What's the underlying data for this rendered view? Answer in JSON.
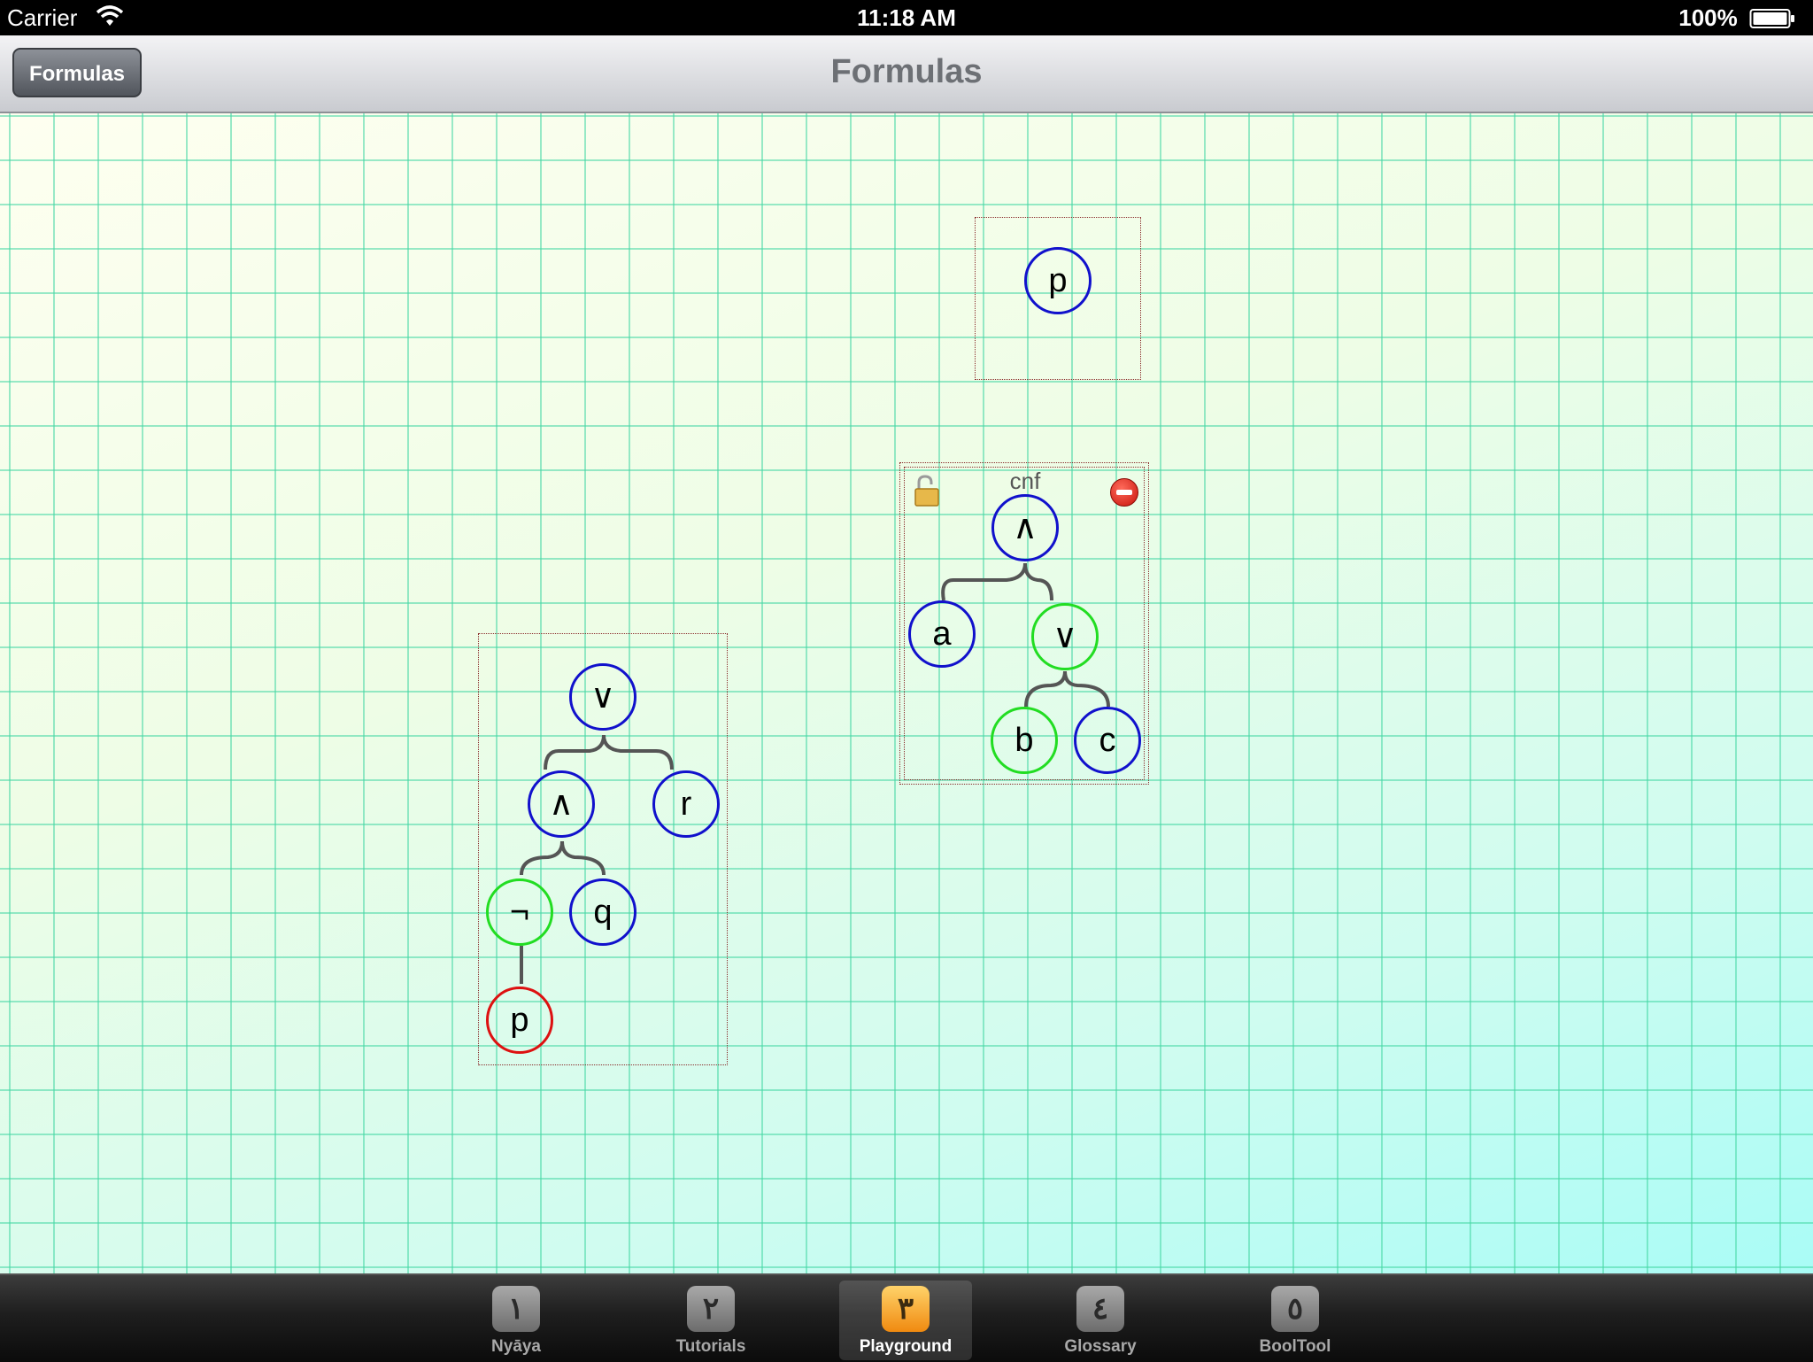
{
  "status_bar": {
    "carrier": "Carrier",
    "time": "11:18 AM",
    "battery": "100%"
  },
  "nav_bar": {
    "title": "Formulas",
    "back_label": "Formulas"
  },
  "canvas": {
    "formula_p": {
      "nodes": [
        "p"
      ]
    },
    "formula_cnf": {
      "label": "cnf",
      "nodes": [
        "∧",
        "a",
        "∨",
        "b",
        "c"
      ]
    },
    "formula_main": {
      "nodes": [
        "∨",
        "∧",
        "r",
        "¬",
        "q",
        "p"
      ]
    }
  },
  "tab_bar": {
    "tabs": [
      {
        "icon": "١",
        "label": "Nyāya"
      },
      {
        "icon": "٢",
        "label": "Tutorials"
      },
      {
        "icon": "٣",
        "label": "Playground"
      },
      {
        "icon": "٤",
        "label": "Glossary"
      },
      {
        "icon": "٥",
        "label": "BoolTool"
      }
    ],
    "active_index": 2
  },
  "colors": {
    "node_blue": "#1111cc",
    "node_green": "#22dd22",
    "node_red": "#dd1111",
    "grid": "#46d7a5"
  },
  "icons": {
    "wifi": "wifi-icon",
    "lock": "lock-open-icon",
    "delete": "delete-icon"
  }
}
